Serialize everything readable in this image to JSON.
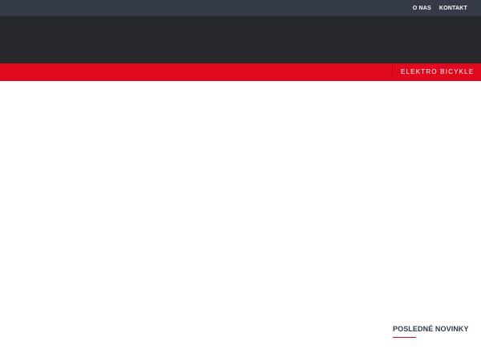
{
  "top_nav": {
    "items": [
      {
        "label": "O NAS"
      },
      {
        "label": "KONTAKT"
      }
    ]
  },
  "main_nav": {
    "items": [
      {
        "label": "ELEKTRO BICYKLE"
      }
    ]
  },
  "news": {
    "title": "POSLEDNÉ NOVINKY"
  },
  "colors": {
    "topbar": "#353c47",
    "header": "#27292c",
    "accent_red": "#e0091e",
    "heading_text": "#2e3b52"
  }
}
